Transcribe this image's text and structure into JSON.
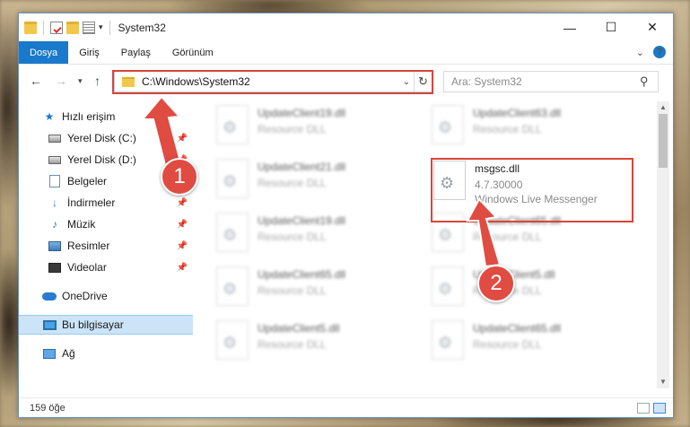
{
  "window": {
    "title": "System32"
  },
  "ribbon": {
    "tabs": [
      "Dosya",
      "Giriş",
      "Paylaş",
      "Görünüm"
    ],
    "active_tab": "Dosya",
    "accent": "#1979ca"
  },
  "address": {
    "path": "C:\\Windows\\System32"
  },
  "search": {
    "placeholder": "Ara: System32"
  },
  "sidebar": {
    "items": [
      {
        "label": "Hızlı erişim",
        "icon": "star-icon",
        "pinned": false
      },
      {
        "label": "Yerel Disk (C:)",
        "icon": "disk-icon",
        "pinned": true
      },
      {
        "label": "Yerel Disk (D:)",
        "icon": "disk-icon",
        "pinned": true
      },
      {
        "label": "Belgeler",
        "icon": "documents-icon",
        "pinned": true
      },
      {
        "label": "İndirmeler",
        "icon": "download-icon",
        "pinned": true
      },
      {
        "label": "Müzik",
        "icon": "music-icon",
        "pinned": true
      },
      {
        "label": "Resimler",
        "icon": "pictures-icon",
        "pinned": true
      },
      {
        "label": "Videolar",
        "icon": "videos-icon",
        "pinned": true
      },
      {
        "label": "OneDrive",
        "icon": "cloud-icon",
        "pinned": false
      },
      {
        "label": "Bu bilgisayar",
        "icon": "computer-icon",
        "pinned": false,
        "selected": true
      },
      {
        "label": "Ağ",
        "icon": "network-icon",
        "pinned": false
      }
    ]
  },
  "files": {
    "left": [
      {
        "name": "UpdateClient19.dll",
        "type": "Resource DLL"
      },
      {
        "name": "UpdateClient21.dll",
        "type": "Resource DLL"
      },
      {
        "name": "UpdateClient19.dll",
        "type": "Resource DLL"
      },
      {
        "name": "UpdateClient65.dll",
        "type": "Resource DLL"
      },
      {
        "name": "UpdateClient5.dll",
        "type": "Resource DLL"
      }
    ],
    "right": [
      {
        "name": "UpdateClient63.dll",
        "type": "Resource DLL"
      },
      {
        "name": "msgsc.dll",
        "version": "4.7.30000",
        "type": "Windows Live Messenger",
        "highlighted": true
      },
      {
        "name": "UpdateClient65.dll",
        "type": "Resource DLL"
      },
      {
        "name": "UpdateClient5.dll",
        "type": "Resource DLL"
      },
      {
        "name": "UpdateClient65.dll",
        "type": "Resource DLL"
      }
    ]
  },
  "status": {
    "count": "159 öğe"
  },
  "annotations": {
    "badge1": "1",
    "badge2": "2",
    "color": "#e04b42"
  }
}
